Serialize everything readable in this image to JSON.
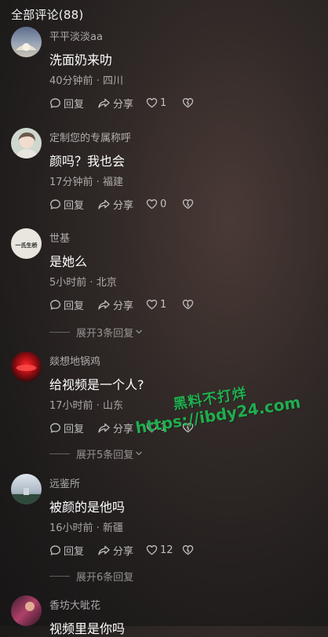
{
  "header": {
    "title": "全部评论(88)"
  },
  "labels": {
    "reply": "回复",
    "share": "分享"
  },
  "comments": [
    {
      "username": "平平淡淡aa",
      "content": "洗面奶来叻",
      "time": "40分钟前",
      "location": "四川",
      "likes": "1",
      "expand": ""
    },
    {
      "username": "定制您的专属称呼",
      "content": "颜吗？我也会",
      "time": "17分钟前",
      "location": "福建",
      "likes": "0",
      "expand": ""
    },
    {
      "username": "世基",
      "content": "是她么",
      "time": "5小时前",
      "location": "北京",
      "likes": "1",
      "expand": "展开3条回复"
    },
    {
      "username": "燚想地锅鸡",
      "content": "给视频是一个人?",
      "time": "17小时前",
      "location": "山东",
      "likes": "1",
      "expand": "展开5条回复"
    },
    {
      "username": "远鉴所",
      "content": "被颜的是他吗",
      "time": "16小时前",
      "location": "新疆",
      "likes": "12",
      "expand": "展开6条回复"
    },
    {
      "username": "香坊大呲花",
      "content": "视频里是你吗",
      "time": "",
      "location": "",
      "likes": "",
      "expand": ""
    }
  ],
  "avatar_text": {
    "shiji": "一氏生桥"
  },
  "watermark": {
    "line1": "黑料不打烊",
    "line2": "https://ibdy24.com"
  },
  "colors": {
    "accent_green": "#1fae4e",
    "muted_text": "#9a9a9a"
  }
}
